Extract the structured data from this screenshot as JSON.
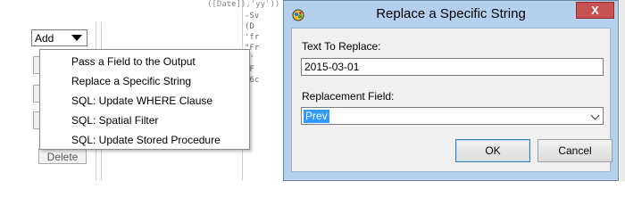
{
  "background_app": {
    "add_select_value": "Add",
    "delete_label": "Delete",
    "code_top": "([Date]),'yy'))",
    "code_lines": [
      "-Sv",
      "(D",
      "'fr",
      "\"Fr",
      "+'",
      "[F",
      "'6c"
    ],
    "dropdown_items": [
      "Pass a Field to the Output",
      "Replace a Specific String",
      "SQL: Update WHERE Clause",
      "SQL: Spatial Filter",
      "SQL: Update Stored Procedure"
    ]
  },
  "dialog": {
    "title": "Replace a Specific String",
    "close_label": "X",
    "text_to_replace_label": "Text To Replace:",
    "text_to_replace_value": "2015-03-01",
    "replacement_field_label": "Replacement Field:",
    "replacement_field_value": "Prev",
    "ok_label": "OK",
    "cancel_label": "Cancel"
  },
  "colors": {
    "dialog_frame": "#b5d0ef",
    "close_button": "#c75050",
    "selection": "#3399ff"
  }
}
